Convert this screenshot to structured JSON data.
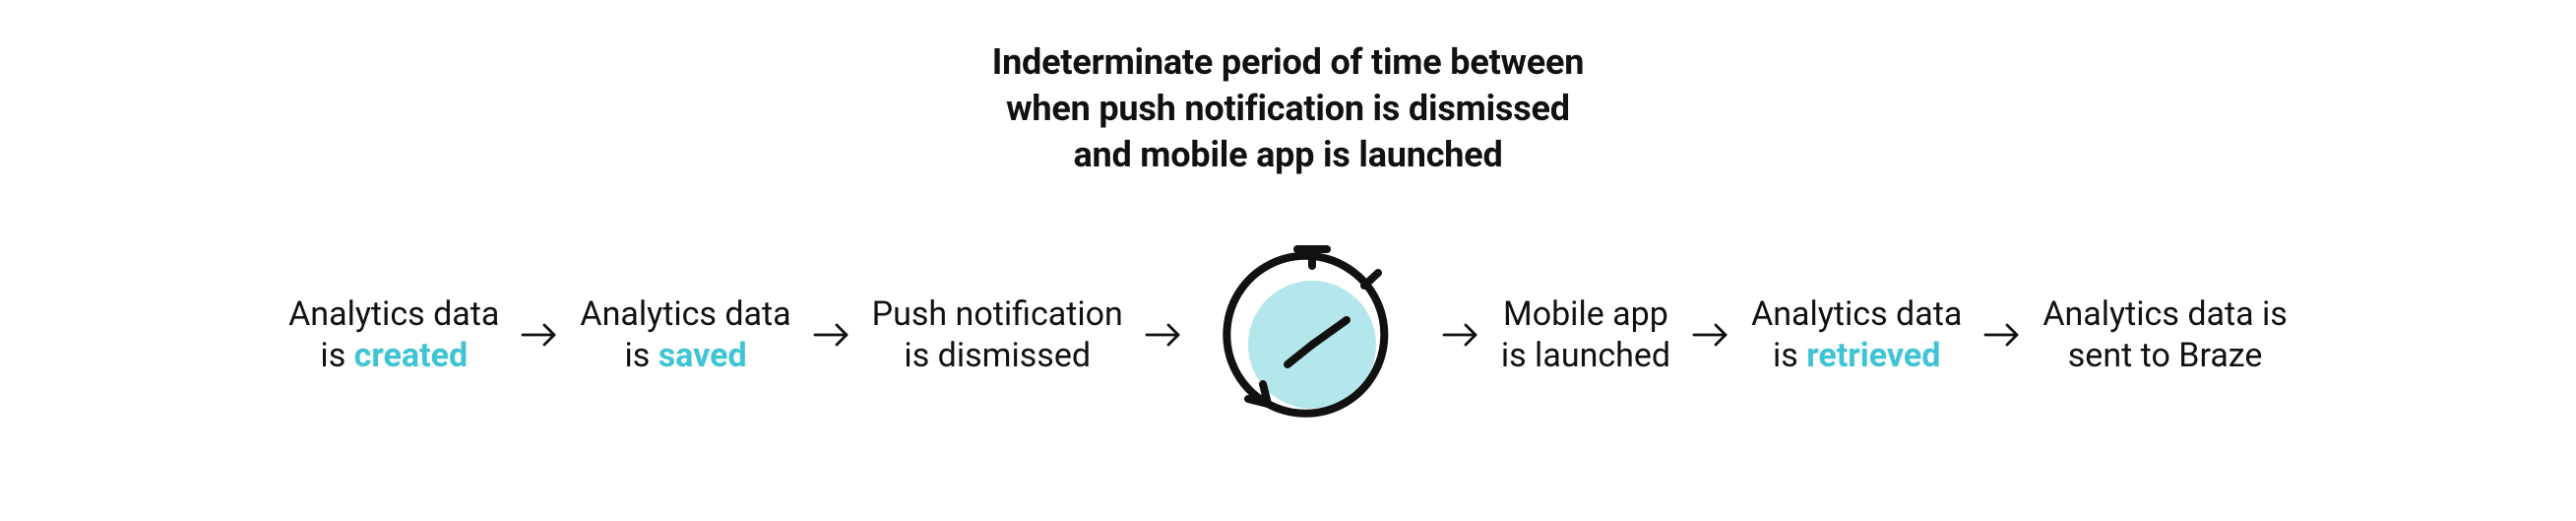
{
  "caption": {
    "line1": "Indeterminate period of time between",
    "line2": "when push notification is dismissed",
    "line3": "and mobile app is launched"
  },
  "steps": {
    "s1": {
      "pre": "Analytics data",
      "mid": "is ",
      "em": "created"
    },
    "s2": {
      "pre": "Analytics data",
      "mid": "is ",
      "em": "saved"
    },
    "s3": {
      "line1": "Push notification",
      "line2": "is dismissed"
    },
    "s4": {
      "line1": "Mobile app",
      "line2": "is launched"
    },
    "s5": {
      "pre": "Analytics data",
      "mid": "is ",
      "em": "retrieved"
    },
    "s6": {
      "line1": "Analytics data is",
      "line2": "sent to Braze"
    }
  },
  "arrow_glyph": "→",
  "accent_color": "#3fc4d3",
  "clock_face_color": "#b4e7ec"
}
